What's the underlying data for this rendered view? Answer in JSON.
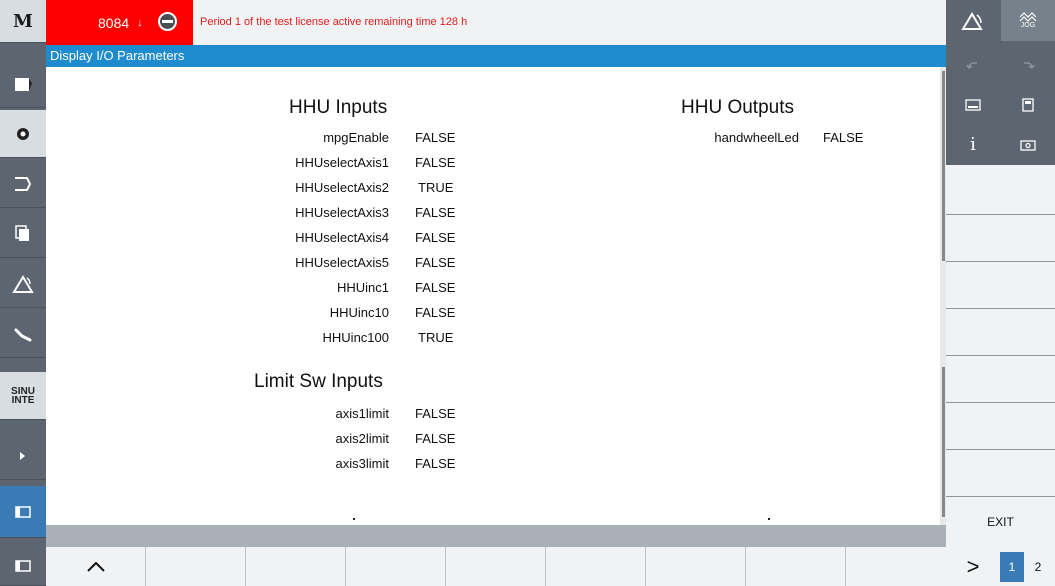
{
  "header": {
    "alarm_number": "8084",
    "alarm_arrow": "↓",
    "license_message": "Period 1 of the test license active remaining time 128 h",
    "license_icon": "license-icon"
  },
  "title_bar": {
    "title": "Display I/O Parameters"
  },
  "left_toolbar": {
    "items": [
      {
        "name": "machine-logo",
        "label": "M"
      },
      {
        "name": "program-icon"
      },
      {
        "name": "program-manager-icon"
      },
      {
        "name": "parameter-icon"
      },
      {
        "name": "copy-icon"
      },
      {
        "name": "alarm-icon"
      },
      {
        "name": "wrench-icon"
      },
      {
        "name": "sinumerik-logo",
        "label": "SINU\nINTE"
      },
      {
        "name": "expand-icon"
      },
      {
        "name": "window-icon"
      },
      {
        "name": "screen-icon"
      }
    ],
    "sinu_label": "SINU",
    "inte_label": "INTE"
  },
  "main": {
    "hhu_inputs": {
      "title": "HHU Inputs",
      "params": [
        {
          "name": "mpgEnable",
          "value": "FALSE"
        },
        {
          "name": "HHUselectAxis1",
          "value": "FALSE"
        },
        {
          "name": "HHUselectAxis2",
          "value": "TRUE"
        },
        {
          "name": "HHUselectAxis3",
          "value": "FALSE"
        },
        {
          "name": "HHUselectAxis4",
          "value": "FALSE"
        },
        {
          "name": "HHUselectAxis5",
          "value": "FALSE"
        },
        {
          "name": "HHUinc1",
          "value": "FALSE"
        },
        {
          "name": "HHUinc10",
          "value": "FALSE"
        },
        {
          "name": "HHUinc100",
          "value": "TRUE"
        }
      ]
    },
    "limit_sw_inputs": {
      "title": "Limit Sw Inputs",
      "params": [
        {
          "name": "axis1limit",
          "value": "FALSE"
        },
        {
          "name": "axis2limit",
          "value": "FALSE"
        },
        {
          "name": "axis3limit",
          "value": "FALSE"
        }
      ]
    },
    "hhu_outputs": {
      "title": "HHU Outputs",
      "params": [
        {
          "name": "handwheelLed",
          "value": "FALSE"
        }
      ]
    }
  },
  "bottom_bar": {
    "up_icon": "chevron-up-icon"
  },
  "right_panel": {
    "jog_label": "JOG",
    "softkeys": [
      "",
      "",
      "",
      "",
      "",
      "",
      "",
      "EXIT"
    ],
    "exit_label": "EXIT",
    "next_label": ">",
    "page_1": "1",
    "page_2": "2"
  }
}
